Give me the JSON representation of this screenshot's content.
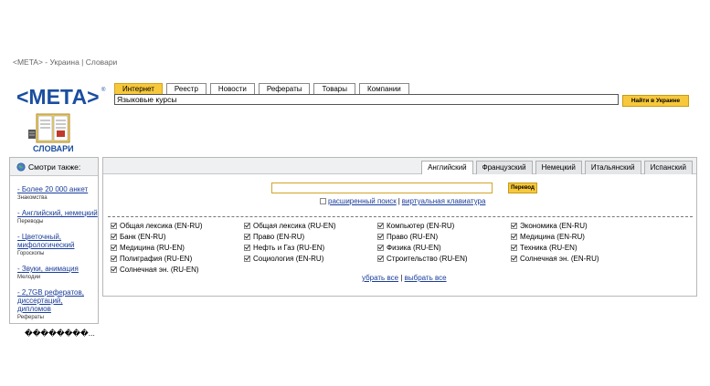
{
  "header": {
    "breadcrumb": "<META> - Украина | Словари"
  },
  "logo": {
    "text": "<МЕТА>",
    "registered": "®"
  },
  "search": {
    "tabs": [
      {
        "label": "Интернет",
        "active": true
      },
      {
        "label": "Реестр",
        "active": false
      },
      {
        "label": "Новости",
        "active": false
      },
      {
        "label": "Рефераты",
        "active": false
      },
      {
        "label": "Товары",
        "active": false
      },
      {
        "label": "Компании",
        "active": false
      }
    ],
    "query": "Языковые курсы",
    "button_label": "Найти в Украине"
  },
  "dictionary": {
    "label": "СЛОВАРИ"
  },
  "sidebar": {
    "header": "Смотри также:",
    "items": [
      {
        "label": "Более 20 000 анкет",
        "sub": "Знакомства"
      },
      {
        "label": "Английский, немецкий",
        "sub": "Переводы"
      },
      {
        "label": "Цветочный, мифологический",
        "sub": "Гороскопы"
      },
      {
        "label": "Звуки, анимация",
        "sub": "Мелодии"
      },
      {
        "label": "2,7GB рефератов, диссертаций, дипломов",
        "sub": "Рефераты"
      }
    ]
  },
  "garbled_text": "��������...",
  "translator": {
    "lang_tabs": [
      {
        "label": "Английский",
        "active": true
      },
      {
        "label": "Французский",
        "active": false
      },
      {
        "label": "Немецкий",
        "active": false
      },
      {
        "label": "Итальянский",
        "active": false
      },
      {
        "label": "Испанский",
        "active": false
      }
    ],
    "input_value": "",
    "button_label": "Перевод",
    "advanced_search": "расширенный поиск",
    "separator": "|",
    "virtual_keyboard": "виртуальная клавиатура",
    "dictionaries": [
      {
        "label": "Общая лексика (EN-RU)",
        "checked": true
      },
      {
        "label": "Общая лексика (RU-EN)",
        "checked": true
      },
      {
        "label": "Компьютер (EN-RU)",
        "checked": true
      },
      {
        "label": "Экономика (EN-RU)",
        "checked": true
      },
      {
        "label": "Банк (EN-RU)",
        "checked": true
      },
      {
        "label": "Право (EN-RU)",
        "checked": true
      },
      {
        "label": "Право (RU-EN)",
        "checked": true
      },
      {
        "label": "Медицина (EN-RU)",
        "checked": true
      },
      {
        "label": "Медицина (RU-EN)",
        "checked": true
      },
      {
        "label": "Нефть и Газ (RU-EN)",
        "checked": true
      },
      {
        "label": "Физика (RU-EN)",
        "checked": true
      },
      {
        "label": "Техника (RU-EN)",
        "checked": true
      },
      {
        "label": "Полиграфия (RU-EN)",
        "checked": true
      },
      {
        "label": "Социология (EN-RU)",
        "checked": true
      },
      {
        "label": "Строительство (RU-EN)",
        "checked": true
      },
      {
        "label": "Солнечная эн. (EN-RU)",
        "checked": true
      },
      {
        "label": "Солнечная эн. (RU-EN)",
        "checked": true
      }
    ],
    "clear_all": "убрать все",
    "select_all": "выбрать все"
  },
  "colors": {
    "accent": "#f7c83b",
    "link": "#1a3d9b",
    "logo": "#1a4ea0"
  }
}
